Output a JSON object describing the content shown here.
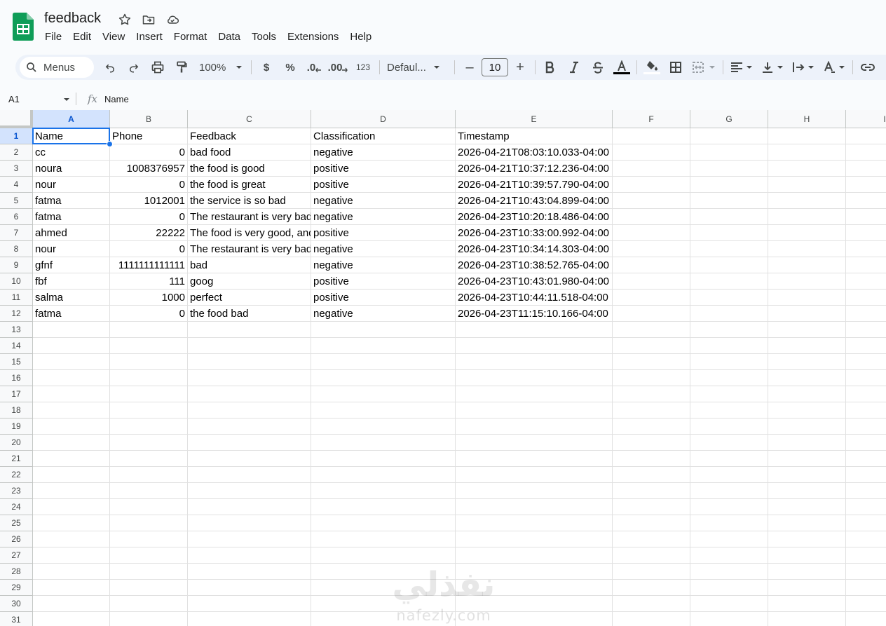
{
  "document": {
    "title": "feedback",
    "icons": [
      "star-icon",
      "move-folder-icon",
      "cloud-status-icon"
    ]
  },
  "menu": [
    "File",
    "Edit",
    "View",
    "Insert",
    "Format",
    "Data",
    "Tools",
    "Extensions",
    "Help"
  ],
  "toolbar": {
    "search_label": "Menus",
    "zoom": "100%",
    "currency": "$",
    "percent": "%",
    "decrease_decimal": ".0",
    "increase_decimal": ".00",
    "number_format": "123",
    "font": "Defaul...",
    "font_size": "10",
    "minus": "–",
    "plus": "+"
  },
  "formula_bar": {
    "cell_ref": "A1",
    "fx": "fx",
    "content": "Name"
  },
  "sheet": {
    "columns": [
      "A",
      "B",
      "C",
      "D",
      "E",
      "F",
      "G",
      "H",
      "I"
    ],
    "row_numbers": [
      "1",
      "2",
      "3",
      "4",
      "5",
      "6",
      "7",
      "8",
      "9",
      "10",
      "11",
      "12",
      "13",
      "14",
      "15",
      "16",
      "17",
      "18",
      "19",
      "20",
      "21",
      "22",
      "23",
      "24",
      "25",
      "26",
      "27",
      "28",
      "29",
      "30",
      "31"
    ],
    "headers": [
      "Name",
      "Phone",
      "Feedback",
      "Classification",
      "Timestamp"
    ],
    "rows": [
      [
        "cc",
        "0",
        "bad food",
        "negative",
        "2026-04-21T08:03:10.033-04:00"
      ],
      [
        "noura",
        "1008376957",
        "the food is good",
        "positive",
        "2026-04-21T10:37:12.236-04:00"
      ],
      [
        "nour",
        "0",
        "the food is great",
        "positive",
        "2026-04-21T10:39:57.790-04:00"
      ],
      [
        "fatma",
        "1012001",
        "the service is so bad",
        "negative",
        "2026-04-21T10:43:04.899-04:00"
      ],
      [
        "fatma",
        "0",
        "The restaurant is very bad",
        "negative",
        "2026-04-23T10:20:18.486-04:00"
      ],
      [
        "ahmed",
        "22222",
        "The food is very good, and",
        "positive",
        "2026-04-23T10:33:00.992-04:00"
      ],
      [
        "nour",
        "0",
        "The restaurant is very bad",
        "negative",
        "2026-04-23T10:34:14.303-04:00"
      ],
      [
        "gfnf",
        "1111111111111",
        "bad",
        "negative",
        "2026-04-23T10:38:52.765-04:00"
      ],
      [
        "fbf",
        "111",
        "goog",
        "positive",
        "2026-04-23T10:43:01.980-04:00"
      ],
      [
        "salma",
        "1000",
        "perfect",
        "positive",
        "2026-04-23T10:44:11.518-04:00"
      ],
      [
        "fatma",
        "0",
        "the food bad",
        "negative",
        "2026-04-23T11:15:10.166-04:00"
      ]
    ]
  },
  "watermark": {
    "arabic": "نفذلي",
    "latin": "nafezly.com"
  },
  "colors": {
    "accent": "#1a73e8",
    "sheets_green": "#0f9d58",
    "selected_header": "#d3e3fd"
  }
}
